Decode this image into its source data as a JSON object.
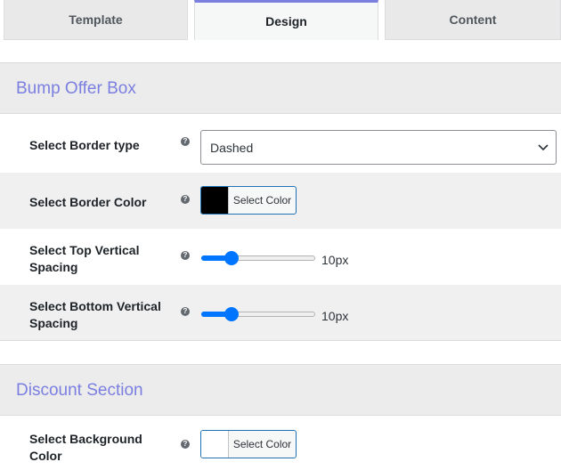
{
  "tabs": [
    {
      "label": "Template",
      "active": false
    },
    {
      "label": "Design",
      "active": true
    },
    {
      "label": "Content",
      "active": false
    }
  ],
  "accent_color": "#7b7fe0",
  "sections": {
    "bump_offer": {
      "title": "Bump Offer Box",
      "border_type": {
        "label": "Select Border type",
        "value": "Dashed"
      },
      "border_color": {
        "label": "Select Border Color",
        "button_label": "Select Color",
        "color": "#000000"
      },
      "top_spacing": {
        "label": "Select Top Vertical Spacing",
        "value_text": "10px",
        "fraction": 0.2
      },
      "bottom_spacing": {
        "label": "Select Bottom Vertical Spacing",
        "value_text": "10px",
        "fraction": 0.2
      }
    },
    "discount": {
      "title": "Discount Section",
      "background_color": {
        "label": "Select Background Color",
        "button_label": "Select Color",
        "color": "#ffffff"
      }
    }
  },
  "help_glyph": "?",
  "icons": {
    "help": "question-circle-icon",
    "dropdown": "chevron-down-icon"
  }
}
